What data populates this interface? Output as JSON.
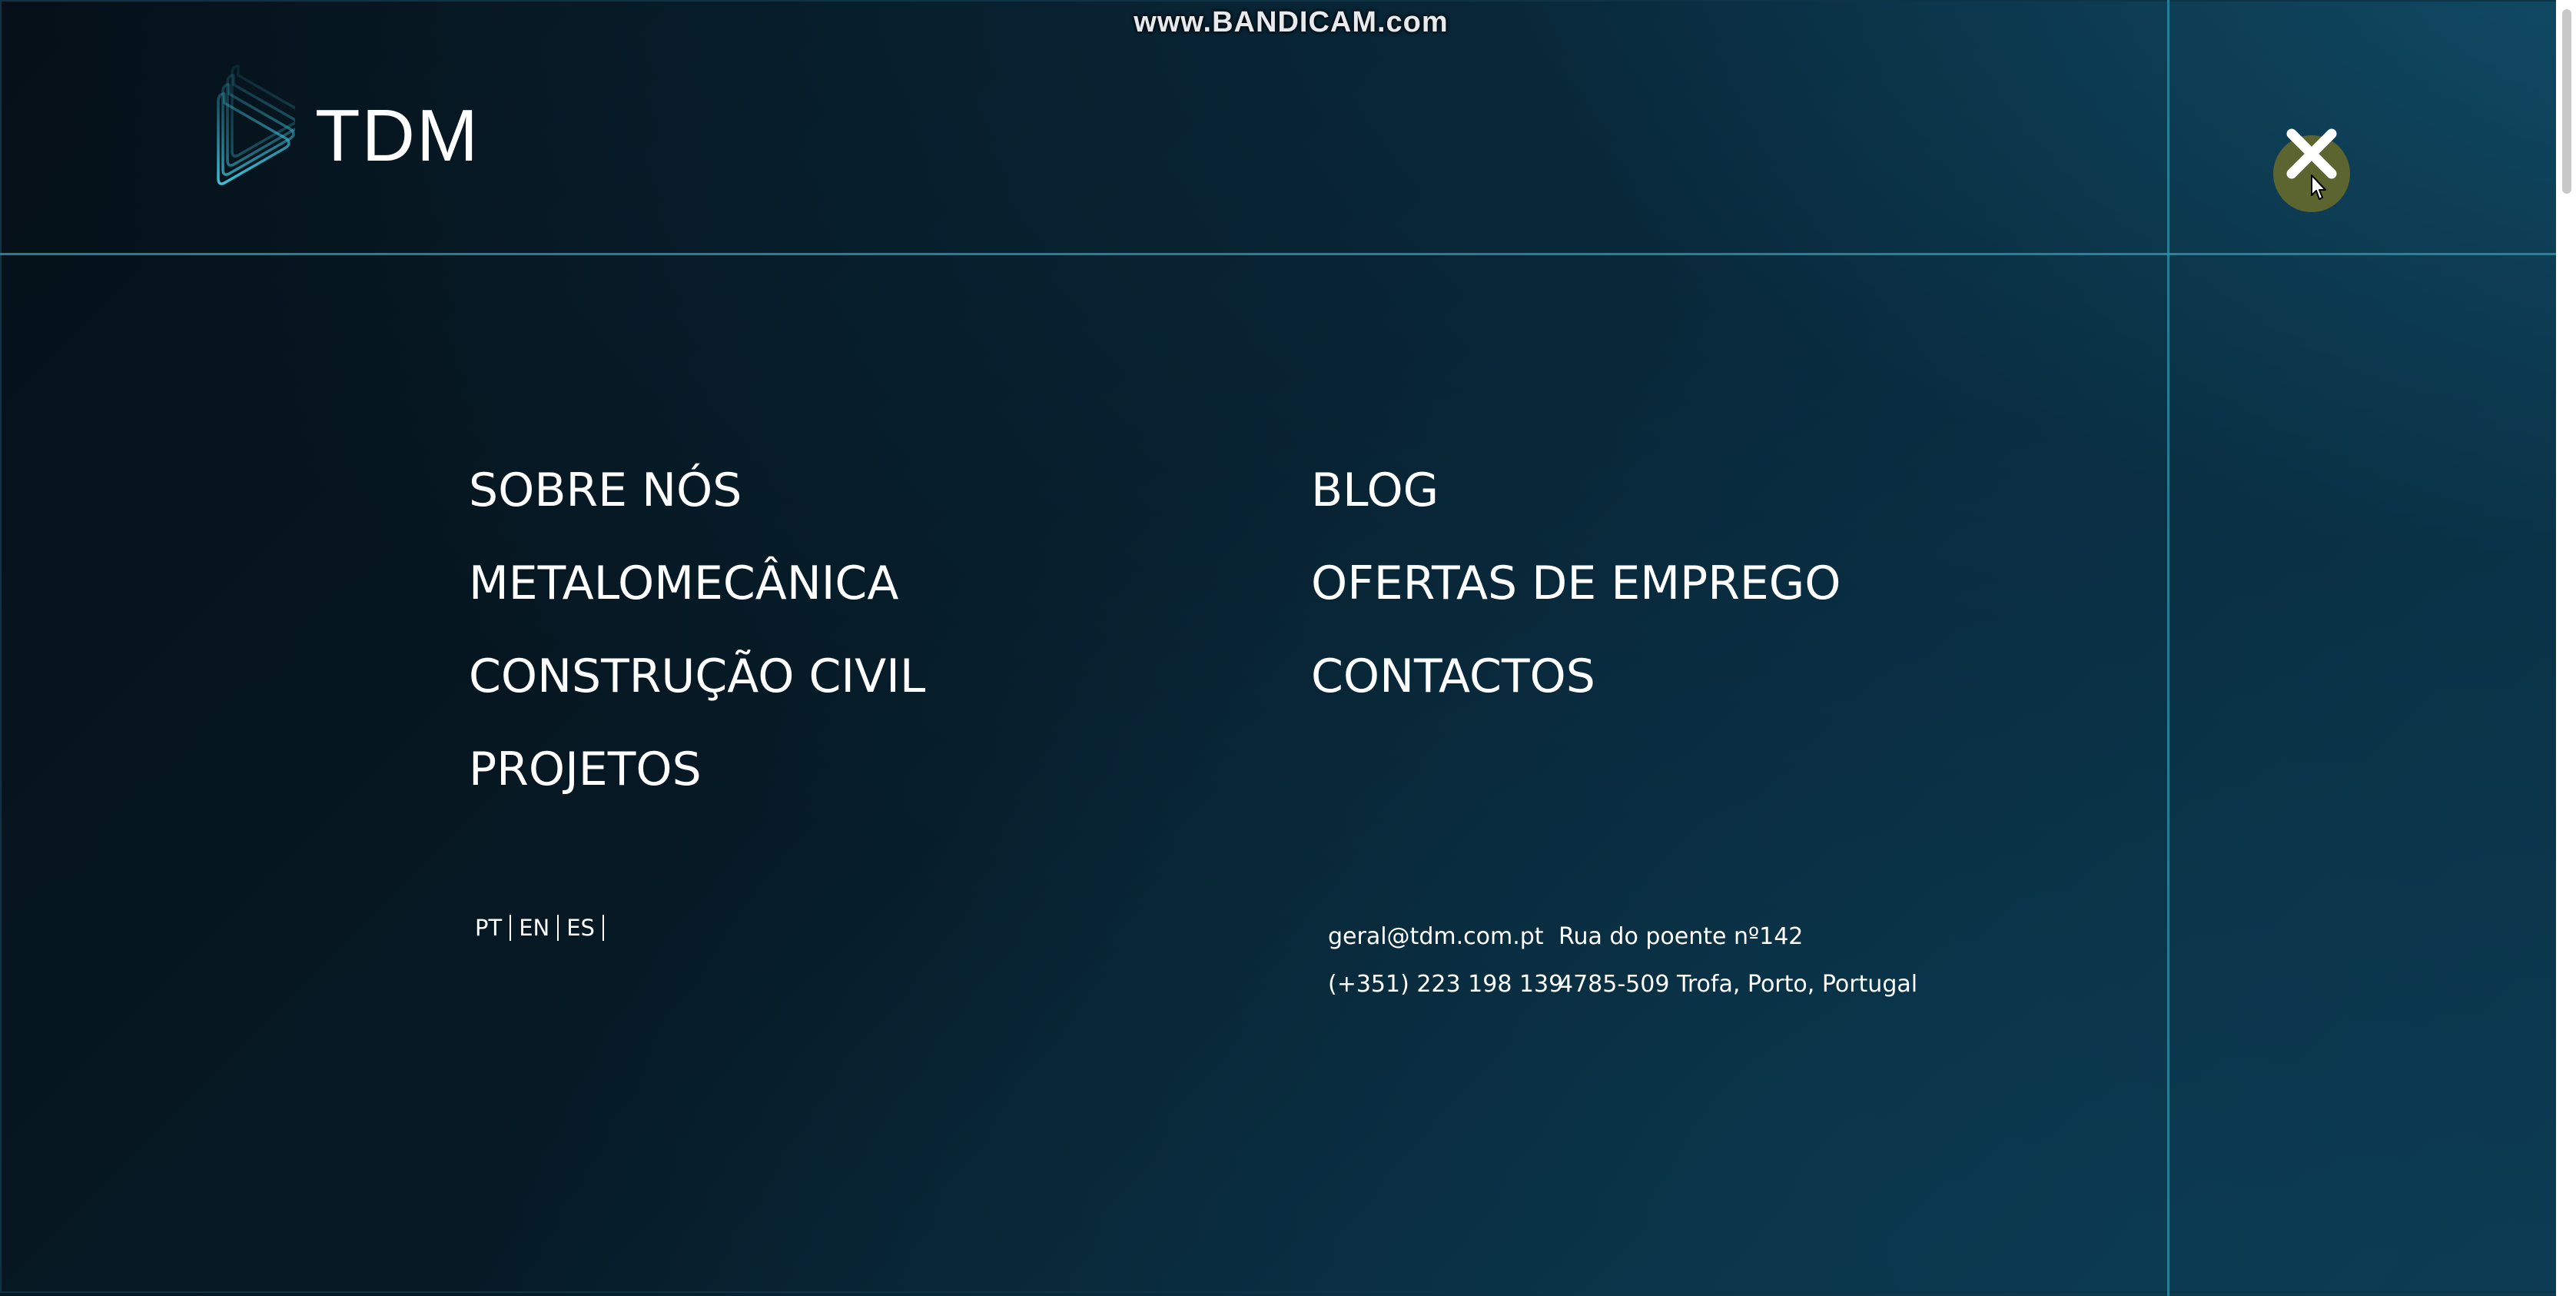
{
  "recording_watermark": "www.BANDICAM.com",
  "header": {
    "logo_text": "TDM",
    "close_icon": "close-icon",
    "close_button_color": "#5c6530"
  },
  "menu": {
    "left": [
      {
        "label": "SOBRE NÓS"
      },
      {
        "label": "METALOMECÂNICA"
      },
      {
        "label": "CONSTRUÇÃO CIVIL"
      },
      {
        "label": "PROJETOS"
      }
    ],
    "right": [
      {
        "label": "BLOG"
      },
      {
        "label": "OFERTAS DE EMPREGO"
      },
      {
        "label": "CONTACTOS"
      }
    ]
  },
  "languages": [
    "PT",
    "EN",
    "ES"
  ],
  "contact": {
    "email": "geral@tdm.com.pt",
    "phone": "(+351) 223 198 139",
    "address_line1": "Rua do poente nº142",
    "address_line2": "4785-509 Trofa, Porto, Portugal"
  },
  "colors": {
    "accent_line": "#2b90a6",
    "background_dark": "#04141f",
    "background_light": "#0d3a52",
    "text": "#ffffff"
  }
}
